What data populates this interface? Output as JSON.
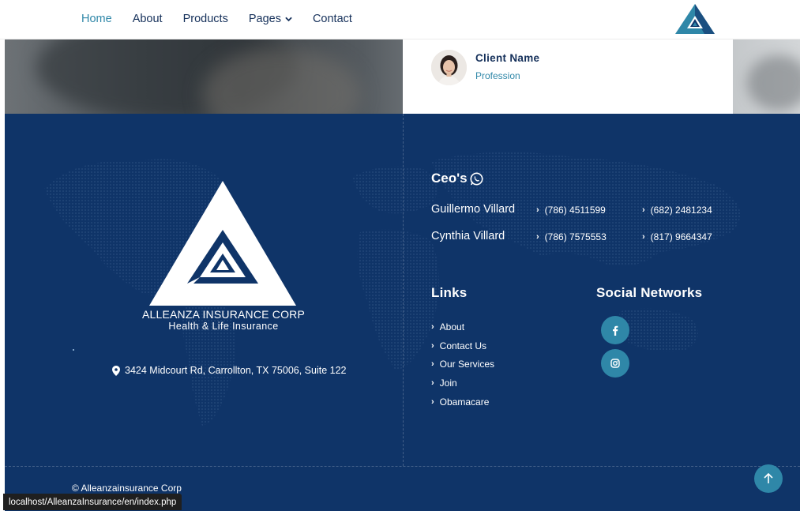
{
  "navbar": {
    "items": [
      {
        "label": "Home"
      },
      {
        "label": "About"
      },
      {
        "label": "Products"
      },
      {
        "label": "Pages"
      },
      {
        "label": "Contact"
      }
    ],
    "active_index": 0,
    "logo_icon": "alleanza-logo-icon"
  },
  "testimonial": {
    "client_name": "Client Name",
    "profession": "Profession",
    "avatar_icon": "client-avatar"
  },
  "footer": {
    "company_name": "ALLEANZA INSURANCE CORP",
    "company_subtitle": "Health & Life Insurance",
    "address": "3424 Midcourt Rd, Carrollton, TX 75006, Suite 122",
    "ceos_title": "Ceo's",
    "ceos": [
      {
        "name": "Guillermo Villard",
        "phone1": "(786) 4511599",
        "phone2": "(682) 2481234"
      },
      {
        "name": "Cynthia Villard",
        "phone1": "(786) 7575553",
        "phone2": "(817) 9664347"
      }
    ],
    "links_title": "Links",
    "links": [
      "About",
      "Contact Us",
      "Our Services",
      "Join",
      "Obamacare"
    ],
    "social_title": "Social Networks",
    "social": [
      "facebook-icon",
      "instagram-icon"
    ],
    "copyright": "© Alleanzainsurance Corp"
  },
  "statusbar": {
    "url": "localhost/AlleanzaInsurance/en/index.php"
  },
  "colors": {
    "navy": "#0f3468",
    "accent": "#2f87a8",
    "nav_text": "#15305a"
  }
}
